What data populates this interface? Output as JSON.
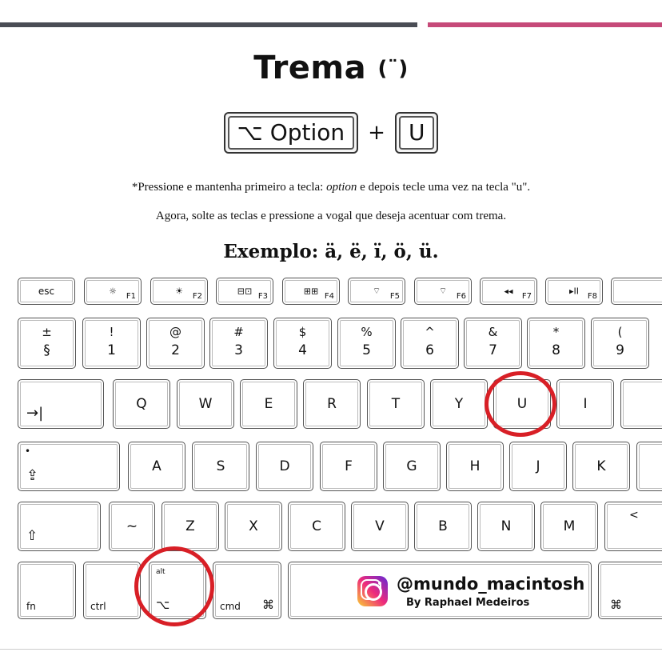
{
  "title": {
    "text": "Trema",
    "symbol": "(¨)"
  },
  "combo": {
    "option_key": "⌥ Option",
    "plus": "+",
    "letter_key": "U"
  },
  "notes": {
    "line1_pre": "*Pressione e mantenha primeiro a tecla: ",
    "line1_em": "option",
    "line1_post": " e depois tecle uma vez na tecla \"u\".",
    "line2": "Agora, solte as teclas e pressione a vogal que deseja acentuar com trema."
  },
  "example": "Exemplo: ä, ë, ï, ö, ü.",
  "keyboard": {
    "fn_row": [
      "esc",
      "☼",
      "F1",
      "☼",
      "F2",
      "▭▭",
      "F3",
      "▦▦",
      "F4",
      "⌔",
      "F5",
      "⌔",
      "F6",
      "◂◂",
      "F7",
      "▸II",
      "F8"
    ],
    "esc": "esc",
    "fkeys": [
      {
        "icon": "☼",
        "label": "F1"
      },
      {
        "icon": "☀",
        "label": "F2"
      },
      {
        "icon": "⊟⊡",
        "label": "F3"
      },
      {
        "icon": "⊞⊞",
        "label": "F4"
      },
      {
        "icon": "⌔",
        "label": "F5"
      },
      {
        "icon": "⌔",
        "label": "F6"
      },
      {
        "icon": "◂◂",
        "label": "F7"
      },
      {
        "icon": "▸II",
        "label": "F8"
      }
    ],
    "num_row": [
      {
        "top": "±",
        "bot": "§"
      },
      {
        "top": "!",
        "bot": "1"
      },
      {
        "top": "@",
        "bot": "2"
      },
      {
        "top": "#",
        "bot": "3"
      },
      {
        "top": "$",
        "bot": "4"
      },
      {
        "top": "%",
        "bot": "5"
      },
      {
        "top": "^",
        "bot": "6"
      },
      {
        "top": "&",
        "bot": "7"
      },
      {
        "top": "*",
        "bot": "8"
      },
      {
        "top": "(",
        "bot": "9"
      }
    ],
    "tab": "→|",
    "row_q": [
      "Q",
      "W",
      "E",
      "R",
      "T",
      "Y",
      "U",
      "I"
    ],
    "caps": "⇪",
    "row_a": [
      "A",
      "S",
      "D",
      "F",
      "G",
      "H",
      "J",
      "K"
    ],
    "shift": "⇧",
    "tilde": "~",
    "row_z": [
      "Z",
      "X",
      "C",
      "V",
      "B",
      "N",
      "M"
    ],
    "lt": "<",
    "fn": "fn",
    "ctrl": "ctrl",
    "alt_top": "alt",
    "alt_bot": "⌥",
    "cmd": "cmd",
    "cmd_sym": "⌘"
  },
  "credit": {
    "handle": "@mundo_macintosh",
    "author": "By Raphael Medeiros"
  },
  "colors": {
    "circle": "#d81f26",
    "bar_dark": "#4a4d55",
    "bar_pink": "#c64a79"
  }
}
